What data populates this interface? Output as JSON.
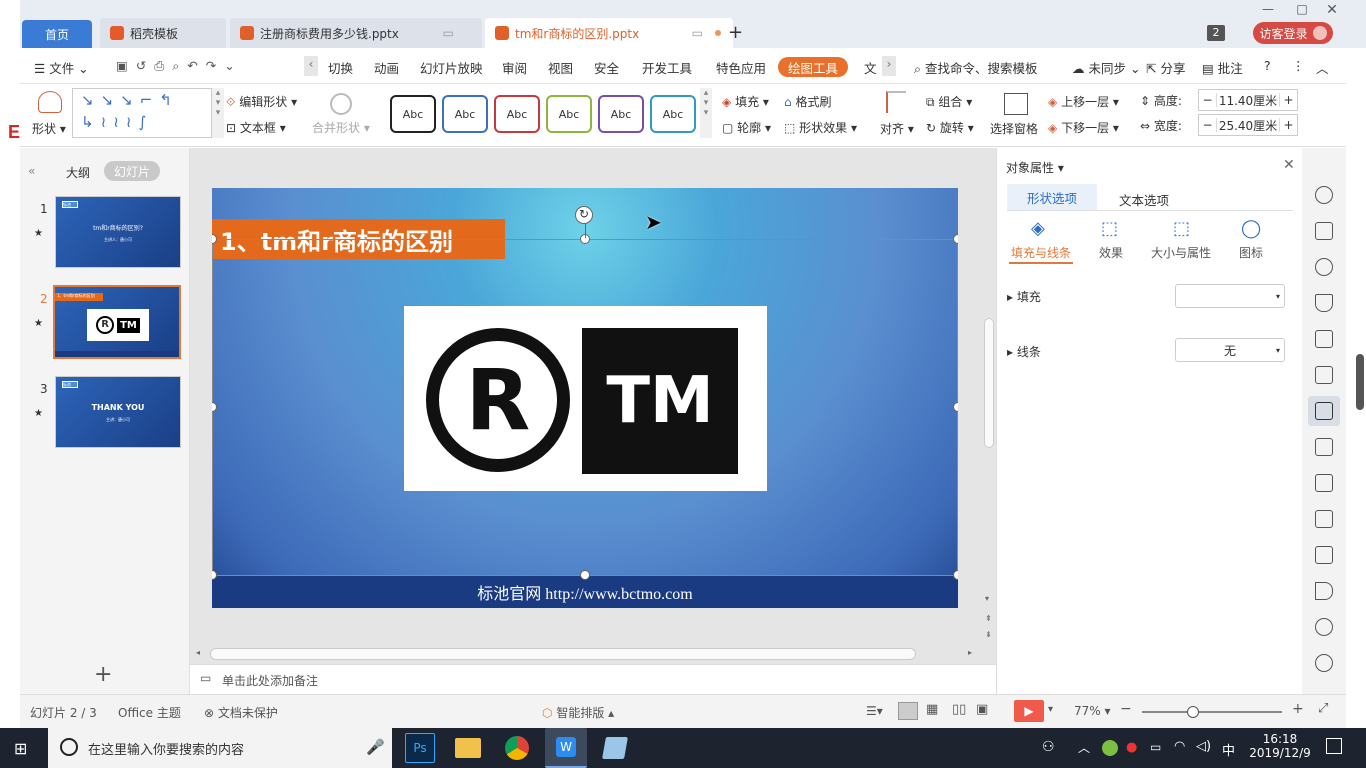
{
  "tabs": {
    "home": "首页",
    "template": "稻壳模板",
    "doc1": "注册商标费用多少钱.pptx",
    "doc2": "tm和r商标的区别.pptx",
    "new_tab": "+",
    "badge": "2",
    "login": "访客登录"
  },
  "menu": {
    "file": "文件",
    "items": [
      "切换",
      "动画",
      "幻灯片放映",
      "审阅",
      "视图",
      "安全",
      "开发工具",
      "特色应用"
    ],
    "draw_tool": "绘图工具",
    "more": "文",
    "search": "查找命令、搜索模板",
    "unsync": "未同步",
    "share": "分享",
    "comment": "批注"
  },
  "ribbon": {
    "shape": "形状",
    "edit_shape": "编辑形状",
    "text_box": "文本框",
    "merge_shape": "合并形状",
    "style_label": "Abc",
    "fill": "填充",
    "format_brush": "格式刷",
    "outline": "轮廓",
    "shape_effect": "形状效果",
    "align": "对齐",
    "group": "组合",
    "rotate": "旋转",
    "select_pane": "选择窗格",
    "bring_forward": "上移一层",
    "send_backward": "下移一层",
    "height_label": "高度:",
    "height_value": "11.40厘米",
    "width_label": "宽度:",
    "width_value": "25.40厘米"
  },
  "style_colors": [
    "#222222",
    "#3a6fc4",
    "#c8373a",
    "#8db63c",
    "#7a4fa0",
    "#2f9bc0"
  ],
  "left_panel": {
    "outline": "大纲",
    "slides": "幻灯片",
    "add": "+",
    "slide_numbers": [
      "1",
      "2",
      "3"
    ],
    "thumb1_title": "tm和r商标的区别?",
    "thumb1_sub": "主讲人：唐小可",
    "thumb1_tag": "标池",
    "thumb2_title": "1、tm和r商标的区别",
    "thumb3_title": "THANK YOU",
    "thumb3_sub": "主讲：唐小可",
    "thumb3_tag": "标池"
  },
  "slide": {
    "title": "1、tm和r商标的区别",
    "logo_r": "R",
    "logo_tm": "TM",
    "footer": "标池官网 http://www.bctmo.com"
  },
  "notes_placeholder": "单击此处添加备注",
  "right_panel": {
    "header": "对象属性",
    "tab_shape": "形状选项",
    "tab_text": "文本选项",
    "sub_fill_line": "填充与线条",
    "sub_effect": "效果",
    "sub_size": "大小与属性",
    "sub_image": "图标",
    "fill_label": "填充",
    "fill_value": "",
    "line_label": "线条",
    "line_value": "无"
  },
  "status": {
    "slide_counter": "幻灯片 2 / 3",
    "theme": "Office 主题",
    "protect": "文档未保护",
    "smart": "智能排版",
    "zoom": "77%"
  },
  "taskbar": {
    "search_placeholder": "在这里输入你要搜索的内容",
    "ime": "中",
    "time": "16:18",
    "date": "2019/12/9"
  }
}
